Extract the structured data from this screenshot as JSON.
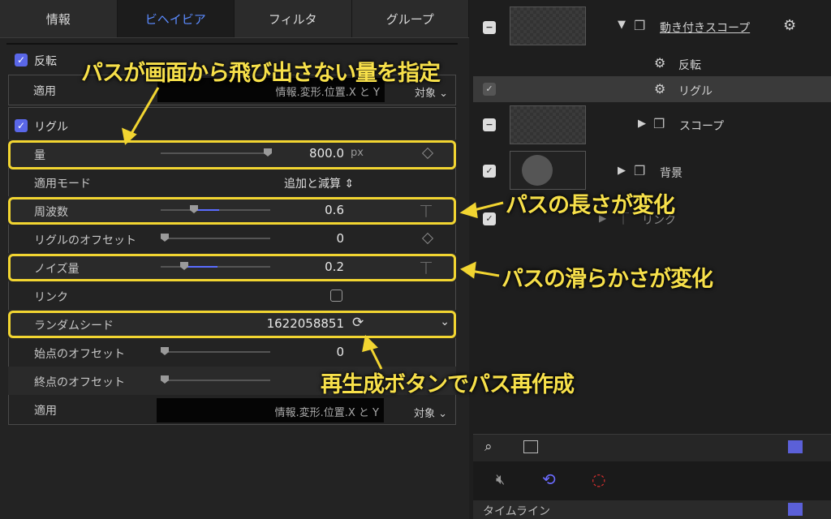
{
  "tabs": [
    "情報",
    "ビヘイビア",
    "フィルタ",
    "グループ"
  ],
  "flip": {
    "label": "反転",
    "apply_label": "適用",
    "apply_value": "情報.変形.位置.X と Y",
    "target_label": "対象"
  },
  "wriggle": {
    "label": "リグル",
    "amount": {
      "label": "量",
      "value": "800.0",
      "unit": "px"
    },
    "apply_mode": {
      "label": "適用モード",
      "value": "追加と減算"
    },
    "frequency": {
      "label": "周波数",
      "value": "0.6"
    },
    "wriggle_offset": {
      "label": "リグルのオフセット",
      "value": "0"
    },
    "noise_amount": {
      "label": "ノイズ量",
      "value": "0.2"
    },
    "link": {
      "label": "リンク"
    },
    "random_seed": {
      "label": "ランダムシード",
      "value": "1622058851"
    },
    "start_offset": {
      "label": "始点のオフセット",
      "value": "0"
    },
    "end_offset": {
      "label": "終点のオフセット",
      "value": "0"
    },
    "apply_label": "適用",
    "apply_value": "情報.変形.位置.X と Y",
    "target_label": "対象"
  },
  "callouts": {
    "amount": "パスが画面から飛び出さない量を指定",
    "length": "パスの長さが変化",
    "smooth": "パスの滑らかさが変化",
    "regen": "再生成ボタンでパス再作成"
  },
  "layers": {
    "group": "動き付きスコープ",
    "flip": "反転",
    "wriggle": "リグル",
    "scope": "スコープ",
    "background": "背景",
    "link": "リンク"
  },
  "timeline_label": "タイムライン"
}
